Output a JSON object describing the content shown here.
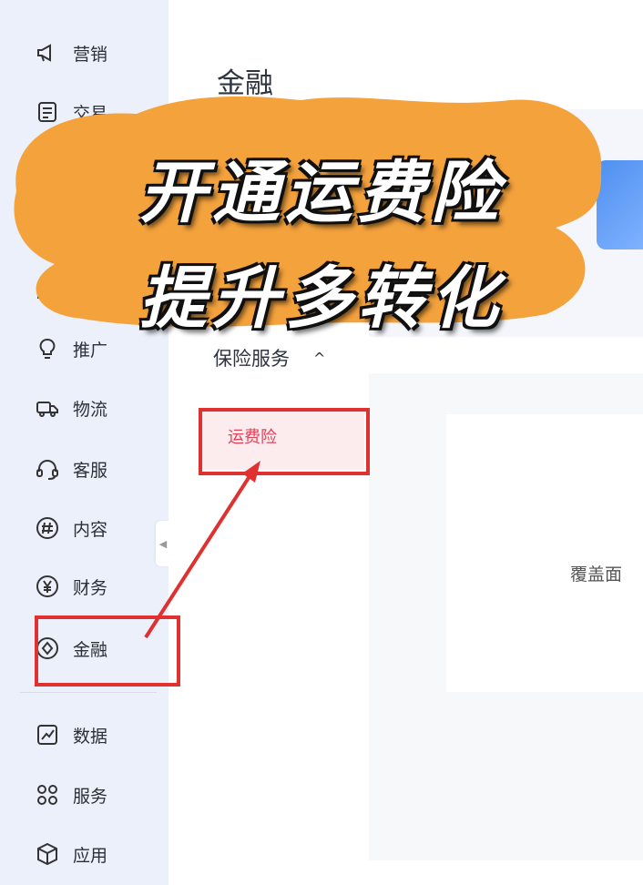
{
  "sidebar": {
    "items": [
      {
        "label": "营销",
        "icon": "megaphone-icon"
      },
      {
        "label": "交易",
        "icon": "order-list-icon"
      },
      {
        "label": "",
        "icon": "user-icon"
      },
      {
        "label": "",
        "icon": "store-icon"
      },
      {
        "label": "推广",
        "icon": "lightbulb-icon"
      },
      {
        "label": "物流",
        "icon": "truck-icon"
      },
      {
        "label": "客服",
        "icon": "headset-icon"
      },
      {
        "label": "内容",
        "icon": "hashtag-icon"
      },
      {
        "label": "财务",
        "icon": "yen-icon"
      },
      {
        "label": "金融",
        "icon": "diamond-circle-icon",
        "active": true
      },
      {
        "label": "数据",
        "icon": "chart-icon"
      },
      {
        "label": "服务",
        "icon": "grid-dots-icon"
      },
      {
        "label": "应用",
        "icon": "cube-icon"
      }
    ]
  },
  "main": {
    "title": "金融",
    "subnav": {
      "group_label": "保险服务",
      "group_chevron": "^",
      "items": [
        {
          "label": "运费险",
          "selected": true
        }
      ]
    },
    "content": {
      "coverage_text": "覆盖面"
    }
  },
  "overlay": {
    "line1": "开通运费险",
    "line2": "提升多转化",
    "highlight_color": "#f4a23c",
    "annotation_color": "#e03131"
  }
}
